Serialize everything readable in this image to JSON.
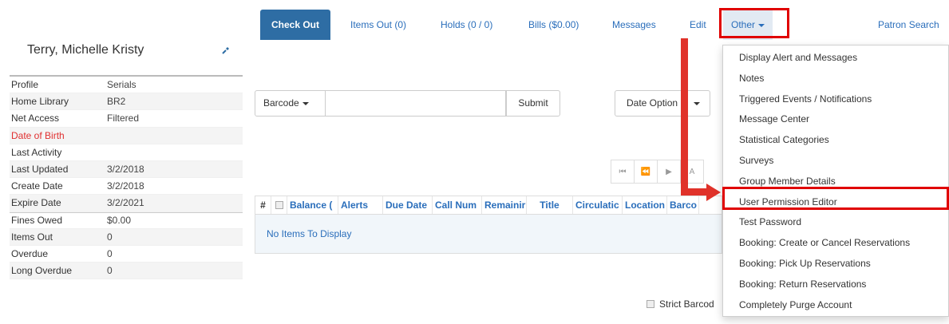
{
  "patron": {
    "name": "Terry, Michelle Kristy",
    "summary": [
      {
        "label": "Profile",
        "value": "Serials"
      },
      {
        "label": "Home Library",
        "value": "BR2"
      },
      {
        "label": "Net Access",
        "value": "Filtered"
      },
      {
        "label": "Date of Birth",
        "value": ""
      },
      {
        "label": "Last Activity",
        "value": ""
      },
      {
        "label": "Last Updated",
        "value": "3/2/2018"
      },
      {
        "label": "Create Date",
        "value": "3/2/2018"
      },
      {
        "label": "Expire Date",
        "value": "3/2/2021"
      },
      {
        "label": "Fines Owed",
        "value": "$0.00"
      },
      {
        "label": "Items Out",
        "value": "0"
      },
      {
        "label": "Overdue",
        "value": "0"
      },
      {
        "label": "Long Overdue",
        "value": "0"
      }
    ]
  },
  "nav": {
    "check_out": "Check Out",
    "items_out": "Items Out (0)",
    "holds": "Holds (0 / 0)",
    "bills": "Bills ($0.00)",
    "messages": "Messages",
    "edit": "Edit",
    "other": "Other",
    "patron_search": "Patron Search"
  },
  "checkout": {
    "barcode_label": "Barcode",
    "barcode_value": "",
    "submit_label": "Submit",
    "date_options_label": "Date Option",
    "strict_barcode_label": "Strict Barcod"
  },
  "pager": {
    "first_icon": "first-page-icon",
    "prev_icon": "previous-page-icon",
    "next_icon": "next-page-icon",
    "partial_label": "A"
  },
  "grid": {
    "columns": [
      "#",
      "",
      "Balance (",
      "Alerts",
      "Due Date",
      "Call Num",
      "Remainir",
      "Title",
      "Circulatic",
      "Location",
      "Barco"
    ],
    "empty_message": "No Items To Display"
  },
  "other_menu": {
    "items": [
      "Display Alert and Messages",
      "Notes",
      "Triggered Events / Notifications",
      "Message Center",
      "Statistical Categories",
      "Surveys",
      "Group Member Details",
      "User Permission Editor",
      "Test Password",
      "Booking: Create or Cancel Reservations",
      "Booking: Pick Up Reservations",
      "Booking: Return Reservations",
      "Completely Purge Account"
    ]
  },
  "colors": {
    "accent": "#2e6da4",
    "link": "#2a6ebb",
    "alert": "#e03030",
    "highlight": "#e00000"
  }
}
